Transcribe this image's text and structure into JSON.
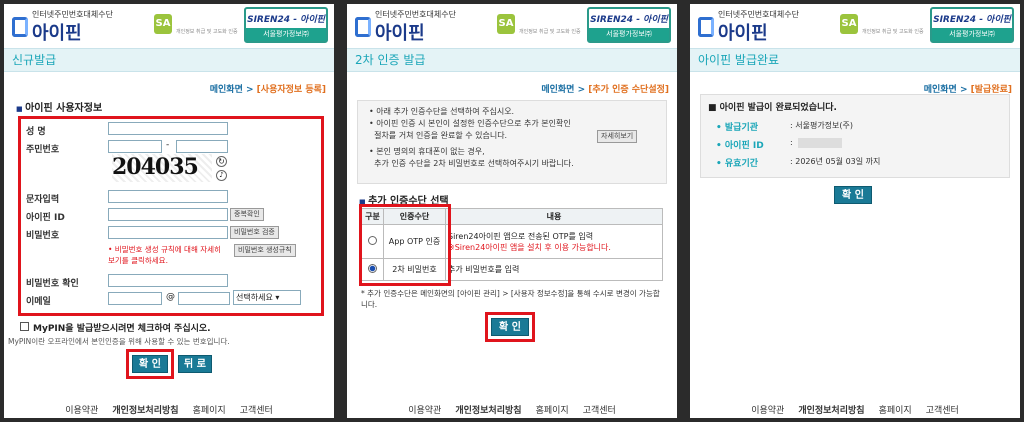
{
  "brand": {
    "tagline": "인터넷주민번호대체수단",
    "name": "아이핀",
    "siren_top": "SIREN24 - 아이핀",
    "siren_bottom": "서울평가정보㈜",
    "sa": "SA",
    "sa_text": "개인정보 취급 및 고도화 인증"
  },
  "p1": {
    "title": "신규발급",
    "crumb_home": "메인화면 >",
    "crumb_cur": "[사용자정보 등록]",
    "section": "아이핀 사용자정보",
    "labels": {
      "name": "성 명",
      "rrn": "주민번호",
      "captcha_input": "문자입력",
      "ipin_id": "아이핀 ID",
      "password": "비밀번호",
      "password_confirm": "비밀번호 확인",
      "email": "이메일"
    },
    "captcha": "204035",
    "rrn_dash": "-",
    "at": "@",
    "email_select": "선택하세요",
    "btn_dup": "중복확인",
    "btn_pw_check": "비밀번호 검증",
    "btn_pw_rule": "비밀번호 생성규칙",
    "pw_note": "• 비밀번호 생성 규칙에 대해 자세히 보기를 클릭하세요.",
    "mypin": "MyPIN을 발급받으시려면 체크하여 주십시오.",
    "mypin_note": "MyPIN이란 오프라인에서 본인인증을 위해 사용할 수 있는 번호입니다.",
    "btn_ok": "확 인",
    "btn_back": "뒤 로"
  },
  "p2": {
    "title": "2차 인증 발급",
    "crumb_home": "메인화면 >",
    "crumb_cur": "[추가 인증 수단설정]",
    "bullets": [
      "• 아래 추가 인증수단을 선택하여 주십시오.",
      "• 아이핀 인증 시 본인이 설정한 인증수단으로 추가 본인확인",
      "  절차를 거쳐 인증을 완료할 수 있습니다.",
      "• 본인 명의의 휴대폰이 없는 경우,",
      "  추가 인증 수단을 2차 비밀번호로 선택하여주시기 바랍니다."
    ],
    "btn_detail": "자세히보기",
    "section": "추가 인증수단 선택",
    "th": [
      "구분",
      "인증수단",
      "내용"
    ],
    "row1": {
      "method": "App OTP 인증",
      "desc": "Siren24아이핀 앱으로 전송된 OTP를 입력",
      "warn": "※Siren24아이핀 앱을 설치 후 이용 가능합니다."
    },
    "row2": {
      "method": "2차 비밀번호",
      "desc": "추가 비밀번호를 입력"
    },
    "note": "* 추가 인증수단은 메인화면의 [아이핀 관리] > [사용자 정보수정]을 통해 수시로 변경이 가능합니다.",
    "btn_ok": "확 인"
  },
  "p3": {
    "title": "아이핀 발급완료",
    "crumb_home": "메인화면 >",
    "crumb_cur": "[발급완료]",
    "done": "아이핀 발급이 완료되었습니다.",
    "l_org": "• 발급기관",
    "v_org": ": 서울평가정보(주)",
    "l_id": "• 아이핀 ID",
    "v_id": ":",
    "l_exp": "• 유효기간",
    "v_exp": ": 2026년 05월 03일 까지",
    "btn_ok": "확 인"
  },
  "footer": {
    "terms": "이용약관",
    "privacy": "개인정보처리방침",
    "home": "홈페이지",
    "support": "고객센터"
  },
  "colors": {
    "highlight": "#e0141c",
    "teal": "#1a7a96",
    "title": "#1aa6b8"
  }
}
